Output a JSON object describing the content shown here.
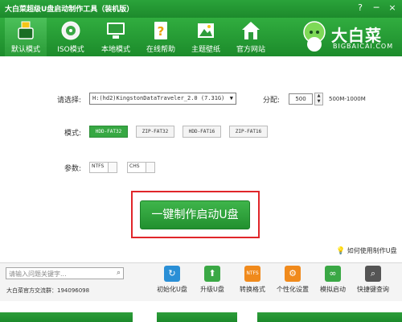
{
  "window": {
    "title": "大白菜超级U盘启动制作工具（装机版）",
    "controls": [
      "?",
      "─",
      "×"
    ]
  },
  "tabs": [
    {
      "label": "默认模式",
      "icon": "usb-drive-icon",
      "active": true
    },
    {
      "label": "ISO模式",
      "icon": "disc-icon",
      "active": false
    },
    {
      "label": "本地模式",
      "icon": "monitor-icon",
      "active": false
    },
    {
      "label": "在线帮助",
      "icon": "help-document-icon",
      "active": false
    },
    {
      "label": "主题壁纸",
      "icon": "wallpaper-icon",
      "active": false
    },
    {
      "label": "官方网站",
      "icon": "home-icon",
      "active": false
    }
  ],
  "logo": {
    "cn": "大白菜",
    "en": "BIGBAICAI.COM"
  },
  "form": {
    "select_label": "请选择:",
    "device_value": "H:(hd2)KingstonDataTraveler_2.0 (7.31G)",
    "alloc_label": "分配:",
    "alloc_value": "500",
    "alloc_range": "500M-1000M",
    "mode_label": "模式:",
    "modes": [
      "HDD-FAT32",
      "ZIP-FAT32",
      "HDD-FAT16",
      "ZIP-FAT16"
    ],
    "param_label": "参数:",
    "params": [
      "NTFS",
      "CHS"
    ]
  },
  "action": {
    "label": "一键制作启动U盘"
  },
  "help_link": "如何使用制作U盘",
  "footer": {
    "search_placeholder": "请输入问题关键字...",
    "qq_group": "大白菜官方交流群：194096098",
    "tools": [
      {
        "label": "初始化U盘",
        "icon": "refresh-icon",
        "color": "#2a8fd6"
      },
      {
        "label": "升级U盘",
        "icon": "upgrade-arrow-icon",
        "color": "#3aa845"
      },
      {
        "label": "转换格式",
        "icon": "ntfs-icon",
        "color": "#f08a1c"
      },
      {
        "label": "个性化设置",
        "icon": "gear-icon",
        "color": "#f08a1c"
      },
      {
        "label": "模拟启动",
        "icon": "link-icon",
        "color": "#3aa845"
      },
      {
        "label": "快捷键查询",
        "icon": "search-icon",
        "color": "#555555"
      }
    ]
  },
  "colors": {
    "brand_green": "#1f8f2e",
    "highlight_red": "#e0262a"
  }
}
